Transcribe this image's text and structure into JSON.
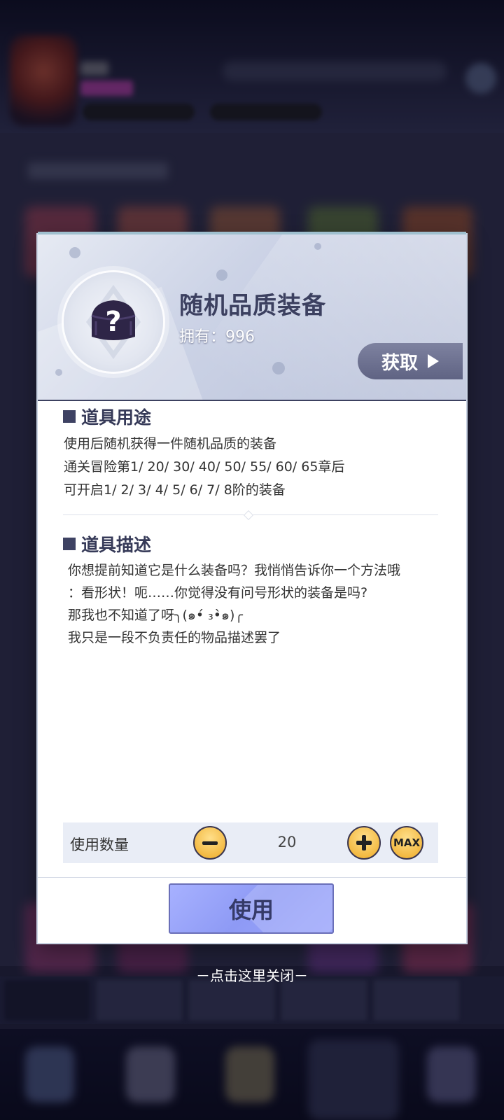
{
  "item": {
    "name": "随机品质装备",
    "owned": "拥有：996",
    "get_label": "获取"
  },
  "usage": {
    "title": "道具用途",
    "lines": [
      "使用后随机获得一件随机品质的装备",
      "通关冒险第1/ 20/ 30/ 40/ 50/ 55/ 60/ 65章后",
      "可开启1/ 2/ 3/ 4/ 5/ 6/ 7/ 8阶的装备"
    ]
  },
  "description": {
    "title": "道具描述",
    "lines": [
      "你想提前知道它是什么装备吗？我悄悄告诉你一个方法哦",
      "：看形状！呃……你觉得没有问号形状的装备是吗?",
      "那我也不知道了呀╮(๑•́ ₃•̀๑)╭",
      "我只是一段不负责任的物品描述罢了"
    ]
  },
  "quantity": {
    "label": "使用数量",
    "value": "20",
    "max_label": "MAX"
  },
  "use_button": "使用",
  "close_hint": "－点击这里关闭－",
  "colors": {
    "accent": "#363a58",
    "use_button": "#9aa4fb",
    "stepper": "#f2b53a"
  }
}
